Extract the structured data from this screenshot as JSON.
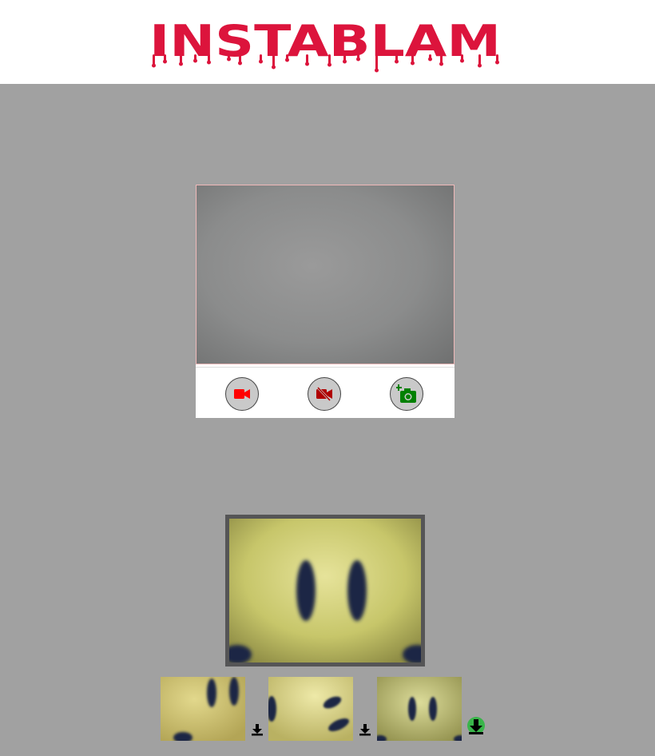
{
  "app": {
    "title": "INSTABLAM",
    "brand_color": "#dc143c"
  },
  "camera": {
    "buttons": [
      {
        "icon": "video-camera-icon",
        "color": "#ff0000"
      },
      {
        "icon": "video-camera-off-icon",
        "color": "#b00000"
      },
      {
        "icon": "add-photo-camera-icon",
        "color": "#008000"
      }
    ]
  },
  "gallery": {
    "preview_icon": "smiley-face-photo",
    "thumbnails": [
      {
        "icon": "smiley-face-photo",
        "download_icon": "download-icon"
      },
      {
        "icon": "smiley-face-photo",
        "download_icon": "download-icon"
      },
      {
        "icon": "smiley-face-photo",
        "download_icon": "download-icon-highlighted"
      }
    ]
  }
}
